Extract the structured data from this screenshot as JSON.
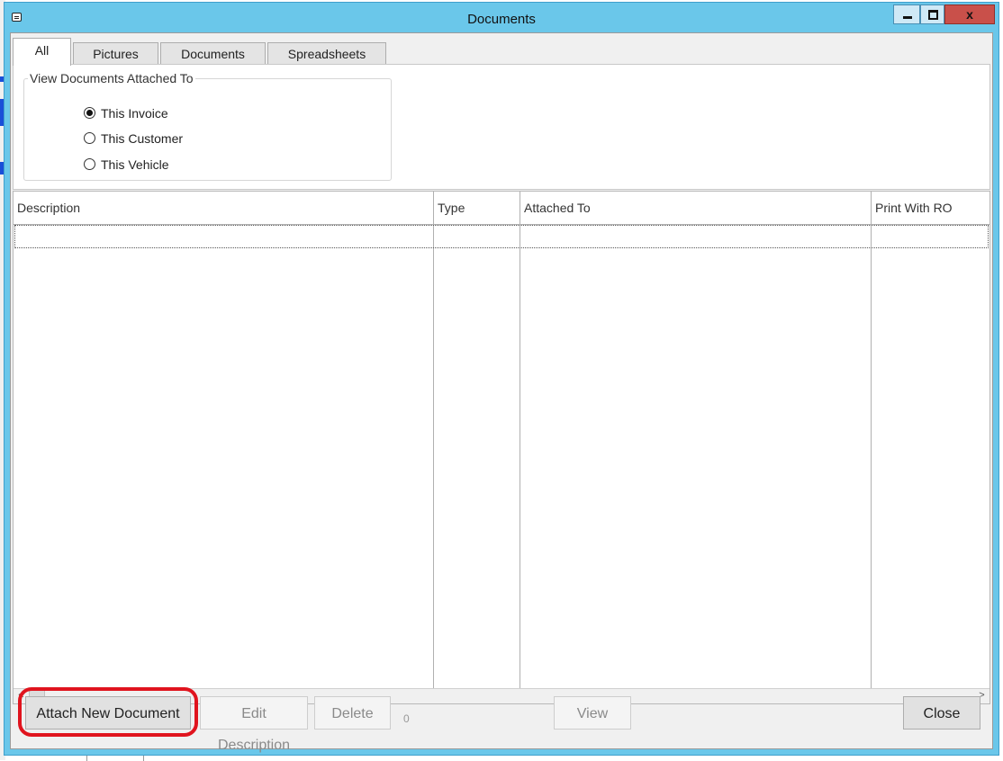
{
  "window": {
    "title": "Documents",
    "close_glyph": "x"
  },
  "tabs": [
    {
      "label": "All",
      "active": true
    },
    {
      "label": "Pictures",
      "active": false
    },
    {
      "label": "Documents",
      "active": false
    },
    {
      "label": "Spreadsheets",
      "active": false
    }
  ],
  "filter_group": {
    "legend": "View Documents Attached To",
    "options": [
      {
        "label": "This Invoice",
        "selected": true
      },
      {
        "label": "This Customer",
        "selected": false
      },
      {
        "label": "This Vehicle",
        "selected": false
      }
    ]
  },
  "grid": {
    "columns": [
      "Description",
      "Type",
      "Attached To",
      "Print With RO"
    ],
    "rows": []
  },
  "buttons": {
    "attach": "Attach New Document",
    "edit": "Edit Description",
    "delete": "Delete",
    "view": "View",
    "close": "Close"
  },
  "document_count": "0",
  "colors": {
    "titlebar": "#6ac7ea",
    "close_button": "#c9504a",
    "highlight": "#e0141e"
  }
}
